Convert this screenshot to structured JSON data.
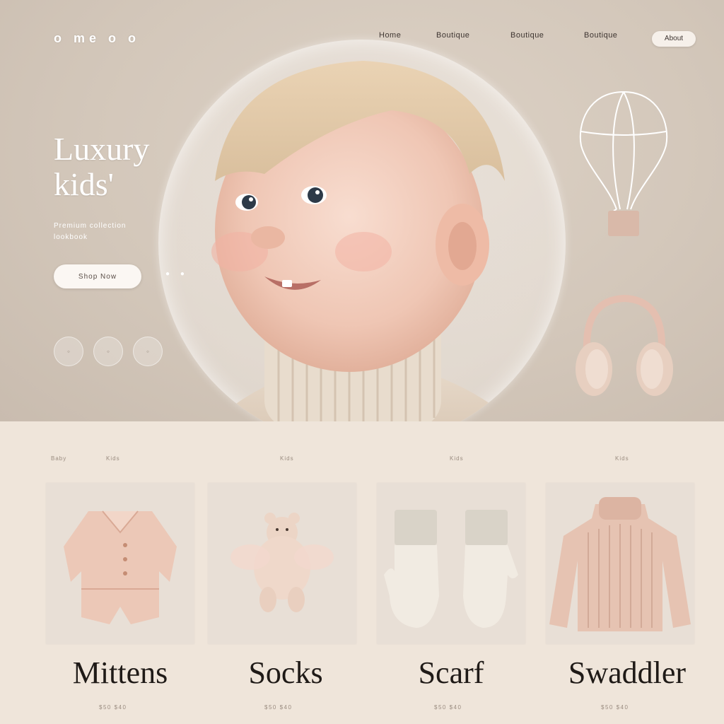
{
  "header": {
    "logo": "o me o o",
    "nav": [
      "Home",
      "Boutique",
      "Boutique",
      "Boutique"
    ],
    "cta": "About"
  },
  "hero": {
    "headline_line1": "Luxury",
    "headline_line2": "kids'",
    "subtext": "Premium collection lookbook",
    "button": "Shop Now",
    "dots": [
      "◦",
      "◦",
      "◦"
    ]
  },
  "products": {
    "labels": [
      "Baby",
      "Kids",
      "Kids",
      "Kids",
      "Kids"
    ],
    "items": [
      {
        "name": "Mittens",
        "price": "$50 $40"
      },
      {
        "name": "Socks",
        "price": "$50 $40"
      },
      {
        "name": "Scarf",
        "price": "$50 $40"
      },
      {
        "name": "Swaddler",
        "price": "$50 $40"
      }
    ]
  },
  "colors": {
    "hero_bg": "#d3c7ba",
    "lower_bg": "#efe5da",
    "accent_pink": "#e8c9bd",
    "text_dark": "#1f1a17"
  }
}
